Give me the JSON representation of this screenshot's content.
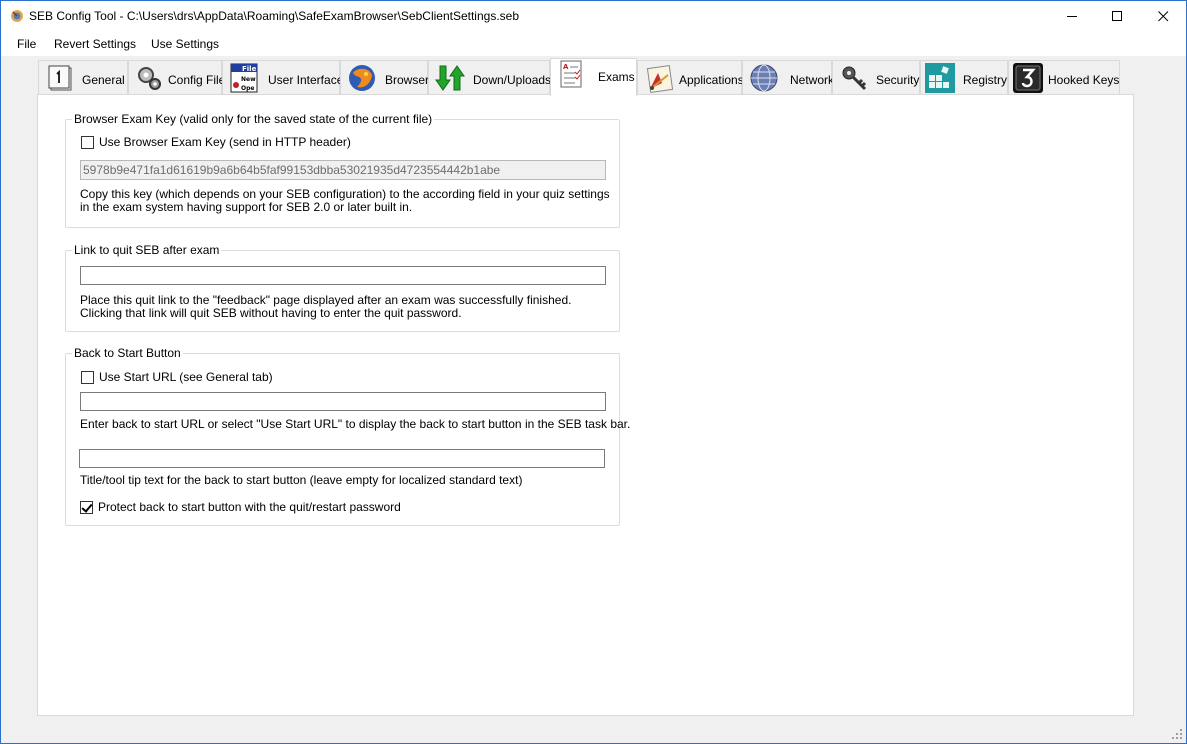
{
  "window": {
    "title": "SEB Config Tool - C:\\Users\\drs\\AppData\\Roaming\\SafeExamBrowser\\SebClientSettings.seb",
    "minimize_icon": "minimize-icon",
    "maximize_icon": "maximize-icon",
    "close_icon": "close-icon"
  },
  "menu": {
    "items": [
      "File",
      "Revert Settings",
      "Use Settings"
    ]
  },
  "tabs": [
    {
      "label": "General",
      "icon": "general-icon"
    },
    {
      "label": "Config File",
      "icon": "config-file-icon"
    },
    {
      "label": "User Interface",
      "icon": "user-interface-icon"
    },
    {
      "label": "Browser",
      "icon": "browser-icon"
    },
    {
      "label": "Down/Uploads",
      "icon": "down-uploads-icon"
    },
    {
      "label": "Exams",
      "icon": "exams-icon",
      "active": true
    },
    {
      "label": "Applications",
      "icon": "applications-icon"
    },
    {
      "label": "Network",
      "icon": "network-icon"
    },
    {
      "label": "Security",
      "icon": "security-icon"
    },
    {
      "label": "Registry",
      "icon": "registry-icon"
    },
    {
      "label": "Hooked Keys",
      "icon": "hooked-keys-icon"
    }
  ],
  "browser_exam_key": {
    "title": "Browser Exam Key (valid only for the saved state of the current file)",
    "use_checkbox_label": "Use Browser Exam Key (send in HTTP header)",
    "use_checked": false,
    "key_value": "5978b9e471fa1d61619b9a6b64b5faf99153dbba53021935d4723554442b1abe",
    "description_line1": "Copy this key (which depends on your SEB configuration) to the according field in your quiz settings",
    "description_line2": "in the exam system having support for SEB 2.0 or later built in."
  },
  "quit_link": {
    "title": "Link to quit SEB after exam",
    "value": "",
    "description_line1": "Place this quit link to the \"feedback\" page displayed after an exam was successfully finished.",
    "description_line2": "Clicking that link will quit SEB without having to enter the quit password."
  },
  "back_to_start": {
    "title": "Back to Start Button",
    "use_start_url_label": "Use Start URL (see General tab)",
    "use_start_url_checked": false,
    "url_value": "",
    "url_description": "Enter back to start URL or select \"Use Start URL\" to display the back to start button in the SEB task bar.",
    "title_value": "",
    "title_description": "Title/tool tip text for the back to start button (leave empty for localized standard text)",
    "protect_label": "Protect back to start button with the quit/restart password",
    "protect_checked": true
  }
}
